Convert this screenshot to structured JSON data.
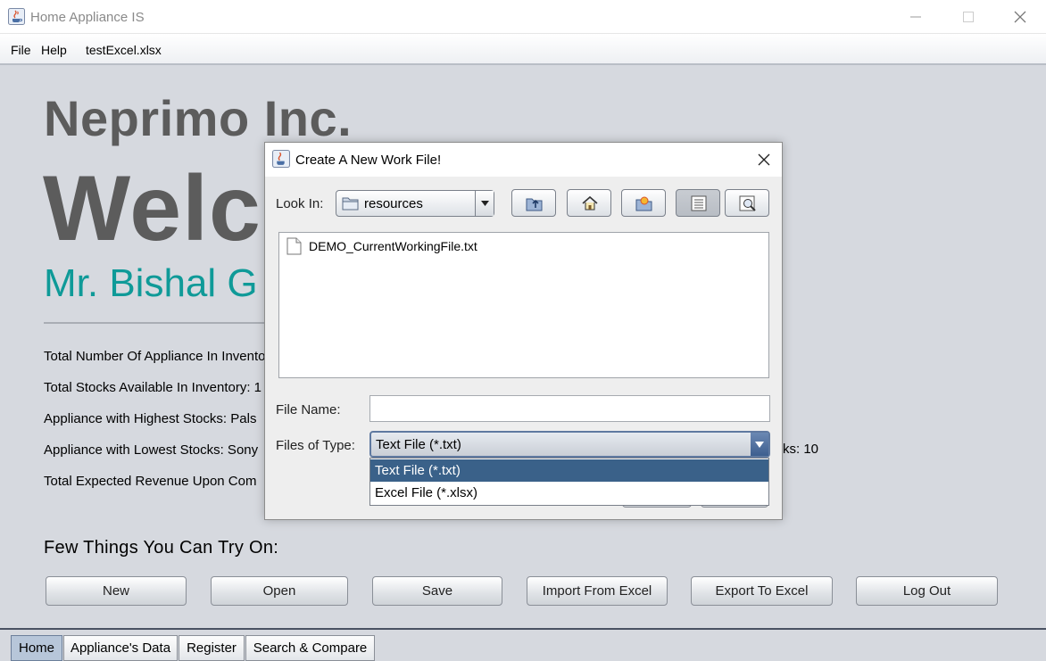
{
  "window": {
    "title": "Home Appliance IS"
  },
  "menubar": {
    "file": "File",
    "help": "Help",
    "current_file": "testExcel.xlsx"
  },
  "home": {
    "company": "Neprimo Inc.",
    "welcome": "Welco",
    "user": "Mr. Bishal G",
    "stats": [
      "Total Number Of Appliance In Invento",
      "Total Stocks Available In Inventory: 1",
      "Appliance with Highest Stocks: Pals",
      "Appliance with Lowest Stocks: Sony",
      "Total Expected Revenue Upon Com"
    ],
    "stat_right": "ks: 10",
    "try_heading": "Few Things You Can Try On:",
    "buttons": {
      "new": "New",
      "open": "Open",
      "save": "Save",
      "import": "Import From Excel",
      "export": "Export To Excel",
      "logout": "Log Out"
    }
  },
  "tabs": {
    "home": "Home",
    "appliances": "Appliance's Data",
    "register": "Register",
    "search": "Search & Compare"
  },
  "dialog": {
    "title": "Create A New Work File!",
    "look_in_label": "Look In:",
    "look_in_value": "resources",
    "files": [
      "DEMO_CurrentWorkingFile.txt"
    ],
    "file_name_label": "File Name:",
    "file_name_value": "",
    "files_of_type_label": "Files of Type:",
    "files_of_type_value": "Text File (*.txt)",
    "type_options": [
      "Text File (*.txt)",
      "Excel File (*.xlsx)"
    ],
    "toolbar_icons": [
      "up-folder-icon",
      "home-icon",
      "new-folder-icon",
      "list-view-icon",
      "details-view-icon"
    ]
  },
  "colors": {
    "accent": "#0f9a98",
    "selection": "#3a6189",
    "heading": "#5c5c5c"
  }
}
